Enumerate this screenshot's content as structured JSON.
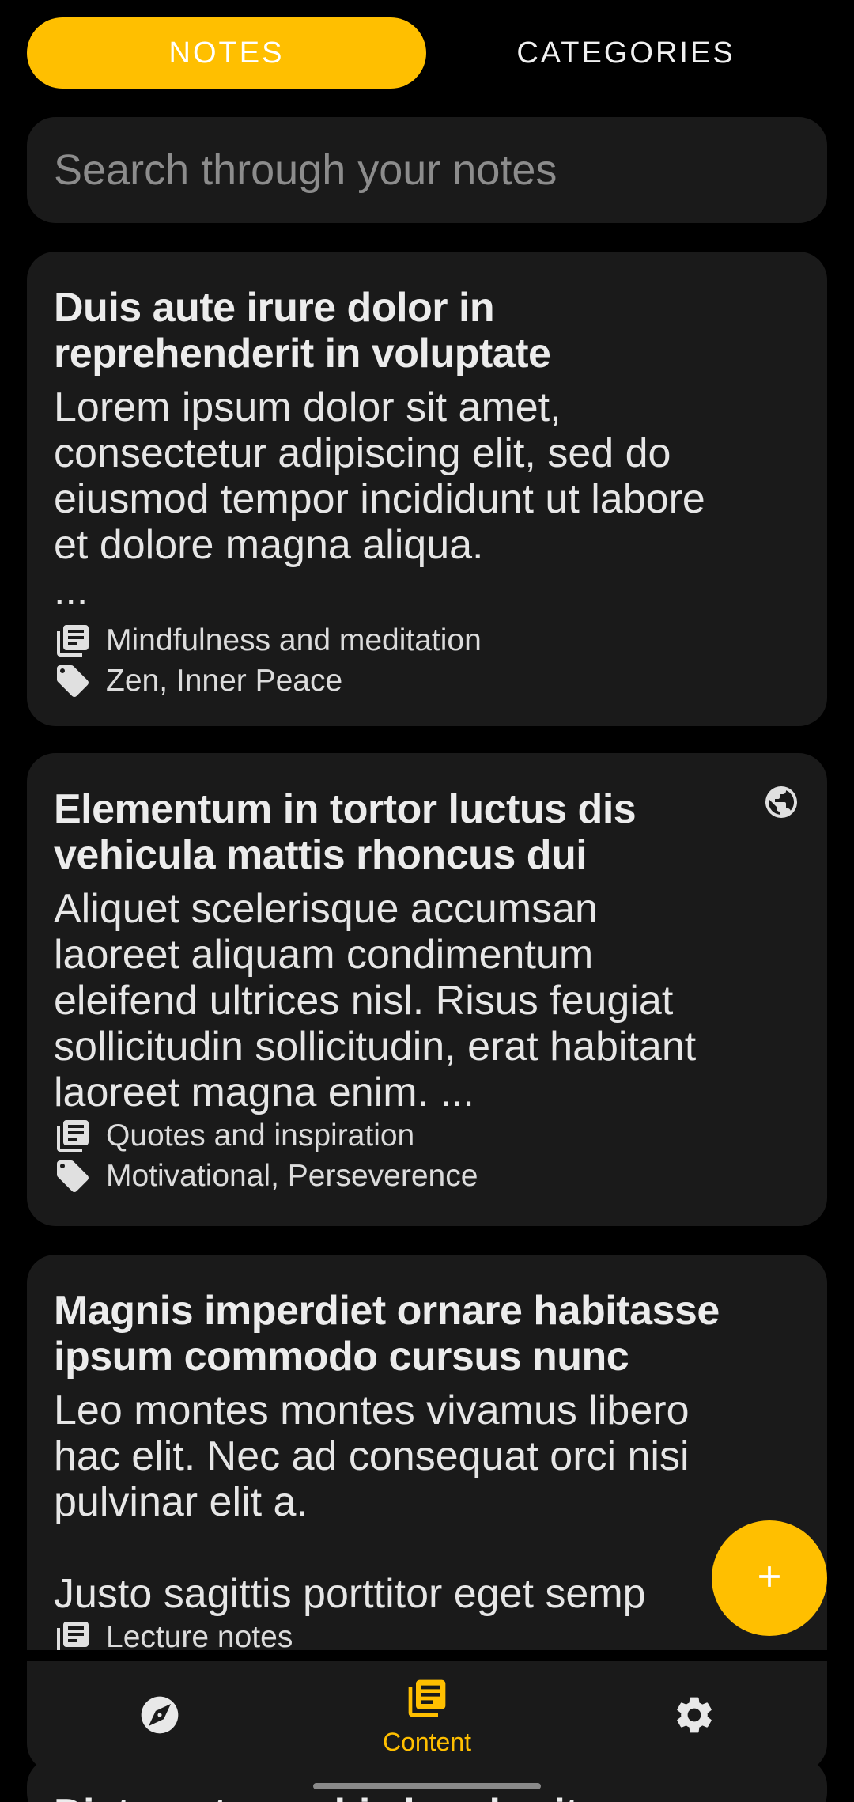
{
  "tabs": {
    "notes": "NOTES",
    "categories": "CATEGORIES"
  },
  "search": {
    "placeholder": "Search through your notes"
  },
  "notes": [
    {
      "title": "Duis aute irure dolor in\nreprehenderit in voluptate",
      "body": "Lorem ipsum dolor sit amet,\nconsectetur adipiscing elit, sed do\neiusmod tempor incididunt ut labore\net dolore magna aliqua.\n...",
      "category": "Mindfulness and meditation",
      "tags": "Zen, Inner Peace"
    },
    {
      "title": "Elementum in tortor luctus dis\nvehicula mattis rhoncus dui",
      "body": "Aliquet scelerisque accumsan\nlaoreet aliquam condimentum\neleifend ultrices nisl. Risus feugiat\nsollicitudin sollicitudin, erat habitant\nlaoreet magna enim. ...",
      "category": "Quotes and inspiration",
      "tags": "Motivational, Perseverence"
    },
    {
      "title": "Magnis imperdiet ornare habitasse\nipsum commodo cursus nunc",
      "body": "Leo montes montes vivamus libero\nhac elit. Nec ad consequat orci nisi\npulvinar elit a.\n\nJusto sagittis porttitor eget semp",
      "category": "Lecture notes"
    },
    {
      "title": "Dictumst conubia hendrerit urna"
    }
  ],
  "nav": {
    "content_label": "Content"
  },
  "colors": {
    "accent": "#ffbf00",
    "card": "#1a1a1a",
    "background": "#000000"
  },
  "icons": [
    "notes-list-icon",
    "tag-icon",
    "globe-icon",
    "compass-icon",
    "settings-gear-icon",
    "plus-icon"
  ]
}
